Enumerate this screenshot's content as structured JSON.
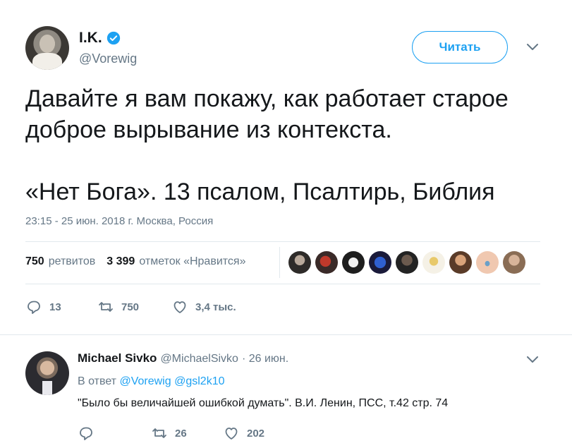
{
  "tweet": {
    "author_name": "I.K.",
    "author_handle": "@Vorewig",
    "follow_label": "Читать",
    "text_line1": "Давайте я вам покажу, как работает старое",
    "text_line2": "доброе вырывание из контекста.",
    "text_line3": "«Нет Бога». 13 псалом, Псалтирь, Библия",
    "timestamp": "23:15 - 25 июн. 2018 г. Москва, Россия",
    "stats": {
      "retweets_count": "750",
      "retweets_label": "ретвитов",
      "likes_count": "3 399",
      "likes_label": "отметок «Нравится»"
    },
    "actions": {
      "reply_count": "13",
      "retweet_count": "750",
      "like_count": "3,4 тыс."
    }
  },
  "reply": {
    "author_name": "Michael Sivko",
    "author_handle": "@MichaelSivko",
    "date": "· 26 июн.",
    "reply_prefix": "В ответ",
    "reply_to_1": "@Vorewig",
    "reply_to_2": "@gsl2k10",
    "text": "\"Было бы величайшей ошибкой думать\". В.И. Ленин, ПСС, т.42 стр. 74",
    "actions": {
      "retweet_count": "26",
      "like_count": "202"
    }
  },
  "colors": {
    "accent": "#1da1f2",
    "muted": "#657786",
    "text": "#14171a",
    "divider": "#e1e8ed"
  }
}
